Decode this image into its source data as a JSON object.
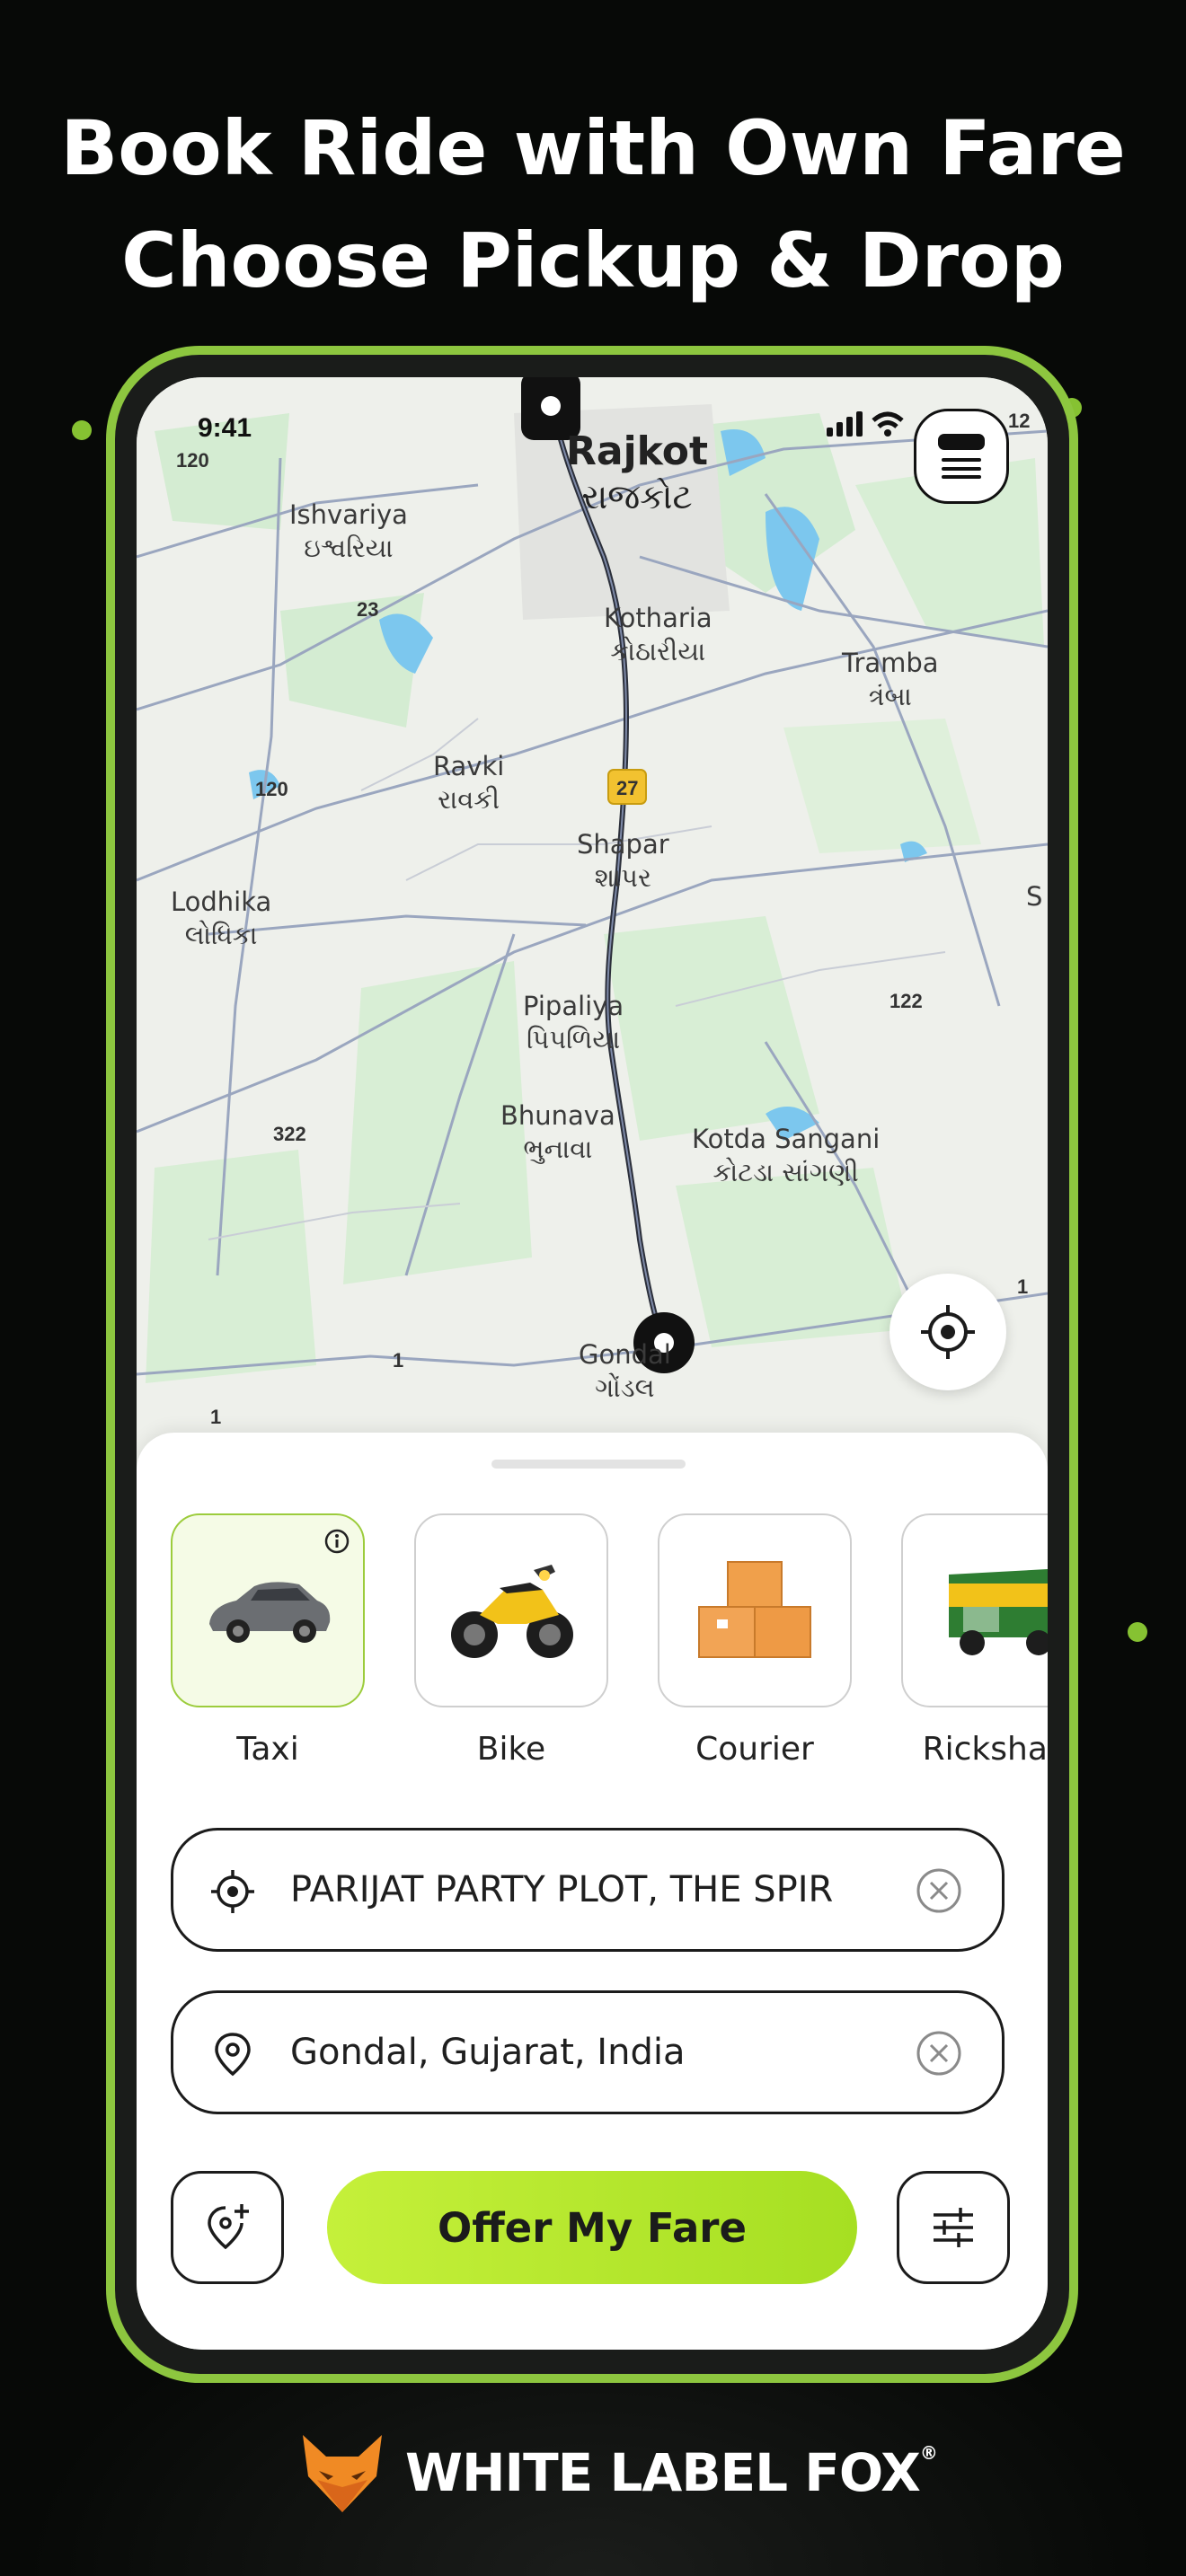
{
  "headline": {
    "line1": "Book Ride with Own Fare",
    "line2": "Choose Pickup & Drop"
  },
  "status_bar": {
    "time": "9:41"
  },
  "map": {
    "labels": {
      "rajkot_en": "Rajkot",
      "rajkot_gu": "રાજકોટ",
      "ishvariya_en": "Ishvariya",
      "ishvariya_gu": "ઇશ્વરિયા",
      "kotharia_en": "Kotharia",
      "kotharia_gu": "કોઠારીયા",
      "tramba_en": "Tramba",
      "tramba_gu": "ત્રંબા",
      "ravki_en": "Ravki",
      "ravki_gu": "રાવકી",
      "shapar_en": "Shapar",
      "shapar_gu": "શાપર",
      "lodhika_en": "Lodhika",
      "lodhika_gu": "લોધિકા",
      "pipaliya_en": "Pipaliya",
      "pipaliya_gu": "પિપળિયા",
      "bhunava_en": "Bhunava",
      "bhunava_gu": "ભુનાવા",
      "kotda_en": "Kotda Sangani",
      "kotda_gu": "કોટડા સાંગણી",
      "gondal_en": "Gondal",
      "gondal_gu": "ગોંડલ",
      "edge_s": "S"
    },
    "shields": {
      "s120a": "120",
      "s23": "23",
      "s120b": "120",
      "s27": "27",
      "s122": "122",
      "s322": "322",
      "s1a": "1",
      "s1b": "1",
      "s1c": "1",
      "s12": "12"
    }
  },
  "vehicles": [
    {
      "label": "Taxi",
      "icon": "car-icon",
      "selected": true
    },
    {
      "label": "Bike",
      "icon": "motorbike-icon",
      "selected": false
    },
    {
      "label": "Courier",
      "icon": "parcel-boxes-icon",
      "selected": false
    },
    {
      "label": "Rickshaw",
      "icon": "rickshaw-icon",
      "selected": false
    }
  ],
  "pickup": {
    "value": "PARIJAT PARTY PLOT, THE SPIR"
  },
  "drop": {
    "value": "Gondal, Gujarat, India"
  },
  "actions": {
    "offer_label": "Offer My Fare"
  },
  "brand": {
    "name": "WHITE LABEL FOX",
    "mark": "®"
  },
  "colors": {
    "accent": "#8dc63f",
    "button": "#b5e82c",
    "background": "#070907"
  }
}
